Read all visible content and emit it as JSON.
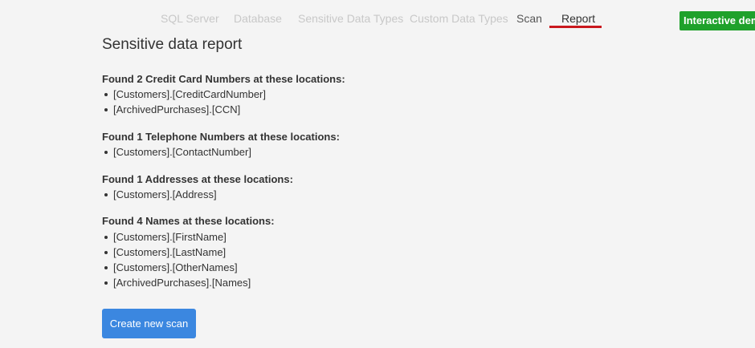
{
  "nav": {
    "tabs": [
      {
        "label": "SQL Server"
      },
      {
        "label": "Database"
      },
      {
        "label": "Sensitive Data Types"
      },
      {
        "label": "Custom Data Types"
      },
      {
        "label": "Scan"
      },
      {
        "label": "Report"
      }
    ],
    "active_tab": "Report",
    "underline_color": "#c9181e"
  },
  "badge": {
    "label": "Interactive demo",
    "color": "#1fa12b"
  },
  "report": {
    "title": "Sensitive data report",
    "groups": [
      {
        "heading": "Found 2 Credit Card Numbers at these locations:",
        "locations": [
          "[Customers].[CreditCardNumber]",
          "[ArchivedPurchases].[CCN]"
        ]
      },
      {
        "heading": "Found 1 Telephone Numbers at these locations:",
        "locations": [
          "[Customers].[ContactNumber]"
        ]
      },
      {
        "heading": "Found 1 Addresses at these locations:",
        "locations": [
          "[Customers].[Address]"
        ]
      },
      {
        "heading": "Found 4 Names at these locations:",
        "locations": [
          "[Customers].[FirstName]",
          "[Customers].[LastName]",
          "[Customers].[OtherNames]",
          "[ArchivedPurchases].[Names]"
        ]
      }
    ]
  },
  "actions": {
    "create_new_scan_label": "Create new scan",
    "button_color": "#3b87e0"
  }
}
